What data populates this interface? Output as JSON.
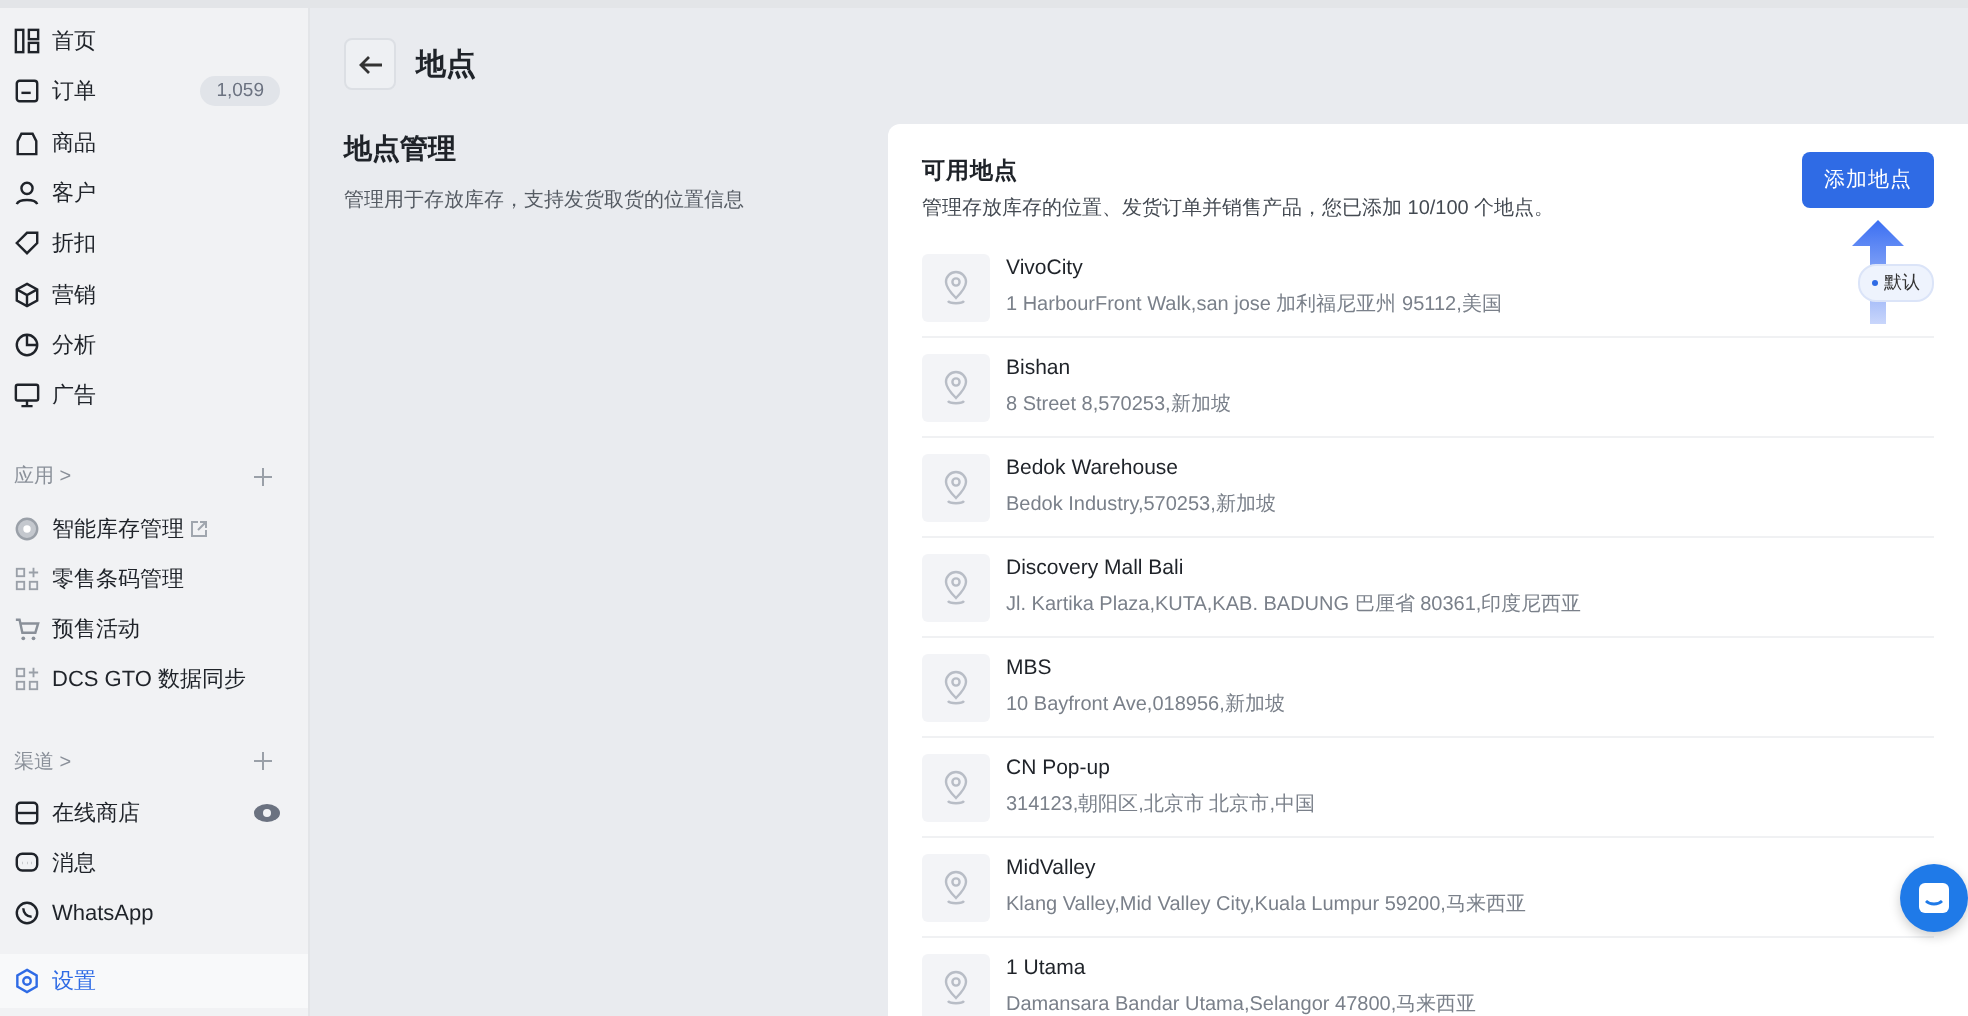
{
  "sidebar": {
    "sections": [
      {
        "items": [
          {
            "label": "首页",
            "selected": false
          },
          {
            "label": "订单",
            "count": "1,059",
            "selected": false
          },
          {
            "label": "商品",
            "selected": false
          },
          {
            "label": "客户",
            "selected": false
          },
          {
            "label": "折扣",
            "selected": false
          },
          {
            "label": "营销",
            "selected": false
          },
          {
            "label": "分析",
            "selected": false
          },
          {
            "label": "广告",
            "selected": false
          }
        ]
      },
      {
        "header": "应用 >",
        "items": [
          {
            "label": "智能库存管理",
            "external": true,
            "selected": false
          },
          {
            "label": "零售条码管理",
            "selected": false
          },
          {
            "label": "预售活动",
            "selected": false
          },
          {
            "label": "DCS GTO 数据同步",
            "selected": false
          }
        ]
      },
      {
        "header": "渠道 >",
        "items": [
          {
            "label": "在线商店",
            "eye": true,
            "selected": false
          },
          {
            "label": "消息",
            "selected": false
          },
          {
            "label": "WhatsApp",
            "selected": false
          }
        ]
      },
      {
        "items": [
          {
            "label": "设置",
            "selected": true
          }
        ]
      }
    ]
  },
  "page": {
    "title": "地点",
    "section_title": "地点管理",
    "section_desc": "管理用于存放库存，支持发货取货的位置信息"
  },
  "card": {
    "title": "可用地点",
    "desc": "管理存放库存的位置、发货订单并销售产品，您已添加 10/100 个地点。",
    "button": "添加地点",
    "locations": [
      {
        "name": "VivoCity",
        "address": "1 HarbourFront Walk,san jose 加利福尼亚州 95112,美国",
        "default_badge": "默认"
      },
      {
        "name": "Bishan",
        "address": "8 Street 8,570253,新加坡"
      },
      {
        "name": "Bedok Warehouse",
        "address": "Bedok Industry,570253,新加坡"
      },
      {
        "name": "Discovery Mall Bali",
        "address": "Jl. Kartika Plaza,KUTA,KAB. BADUNG 巴厘省 80361,印度尼西亚"
      },
      {
        "name": "MBS",
        "address": "10 Bayfront Ave,018956,新加坡"
      },
      {
        "name": "CN Pop-up",
        "address": "314123,朝阳区,北京市 北京市,中国"
      },
      {
        "name": "MidValley",
        "address": "Klang Valley,Mid Valley City,Kuala Lumpur 59200,马来西亚"
      },
      {
        "name": "1 Utama",
        "address": "Damansara Bandar Utama,Selangor 47800,马来西亚"
      }
    ]
  }
}
